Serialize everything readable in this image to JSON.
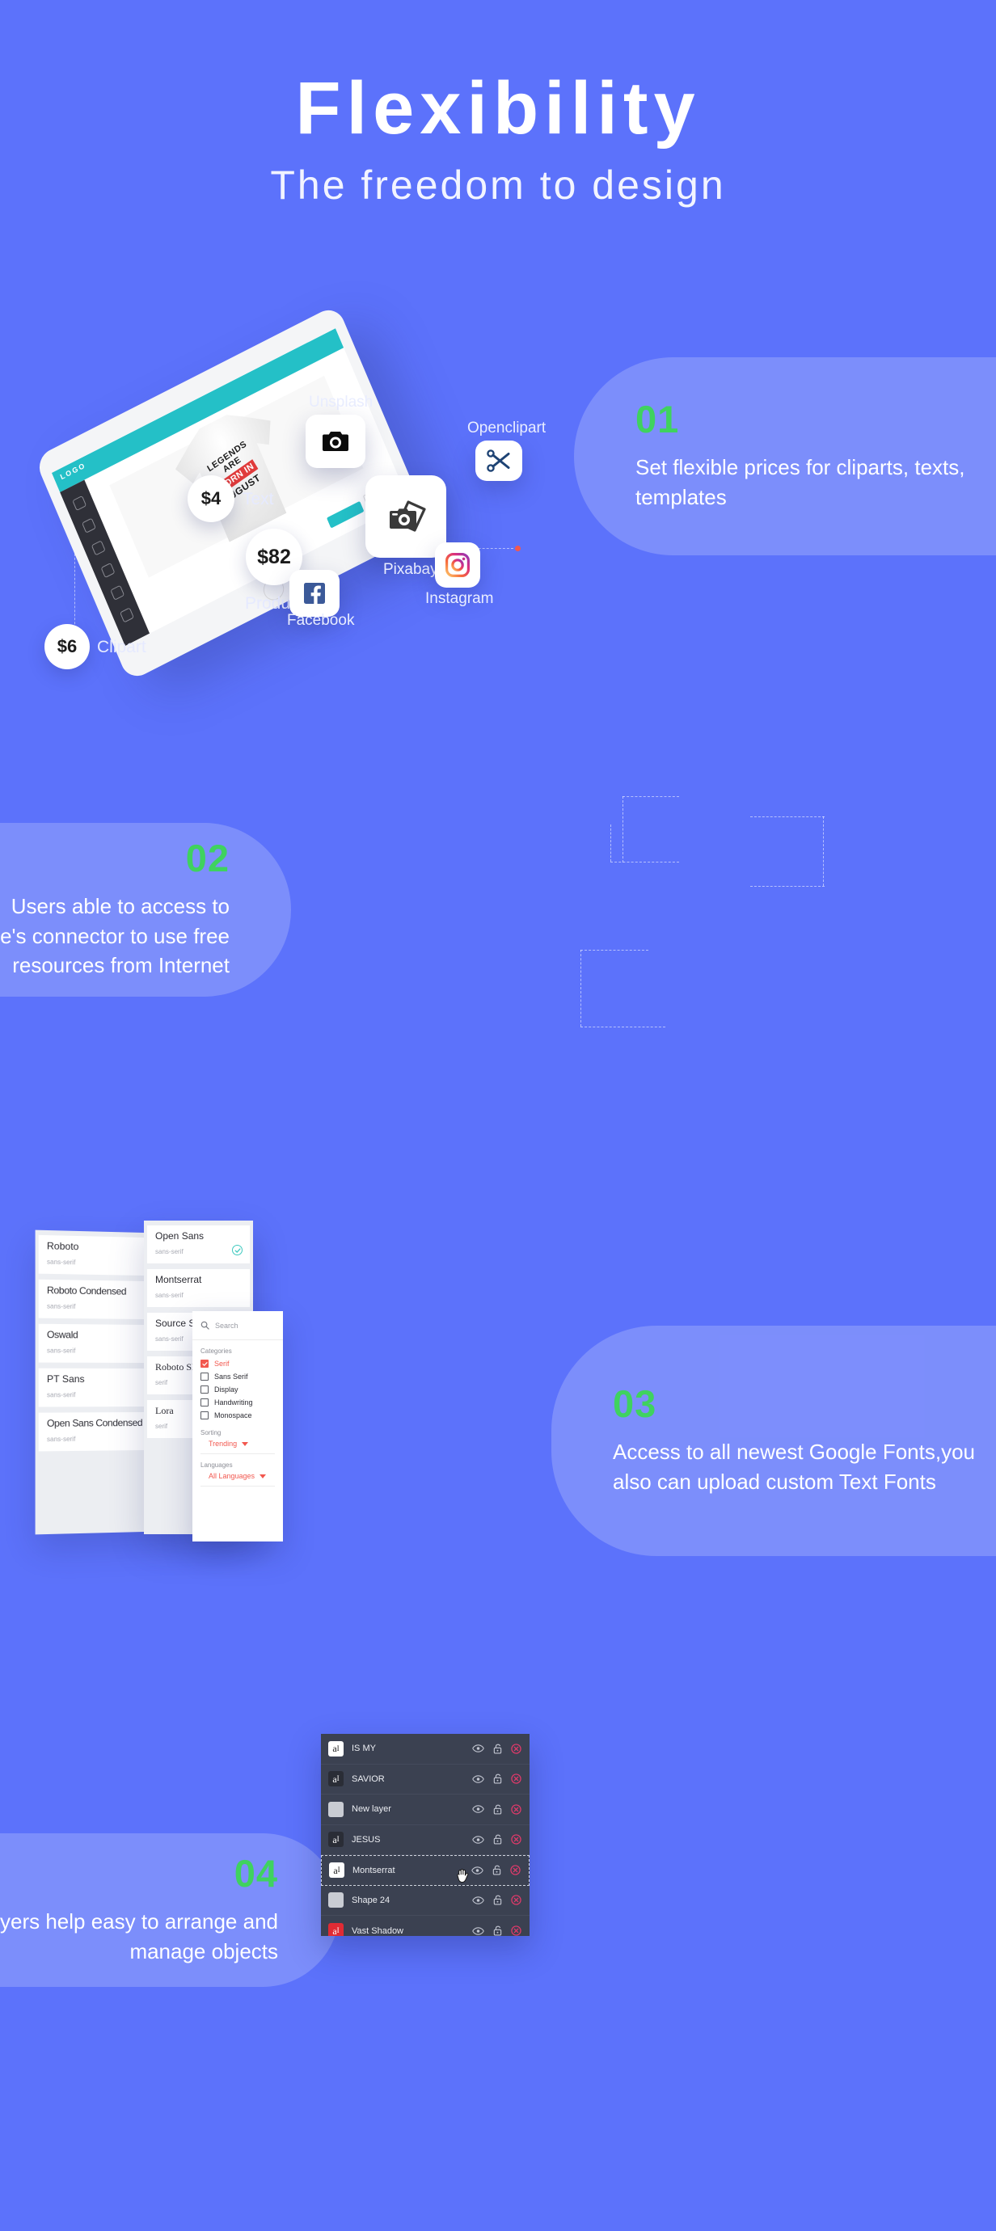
{
  "theme": {
    "background": "#5c72fb",
    "card_tint": "#7f94fc",
    "accent_green": "#3fd25f",
    "accent_red": "#f2584f",
    "accent_teal": "#3fc9bf",
    "panel_dark": "#3b4151"
  },
  "header": {
    "title": "Flexibility",
    "subtitle": "The freedom to design"
  },
  "section01": {
    "number": "01",
    "text": "Set flexible prices for cliparts, texts, templates",
    "bubbles": [
      {
        "price": "$4",
        "label": "Text"
      },
      {
        "price": "$82",
        "label": "Product"
      },
      {
        "price": "$6",
        "label": "Clipart"
      }
    ],
    "tablet": {
      "logo": "LOGO",
      "tee_line1": "LEGENDS ARE",
      "tee_line2": "BORN IN",
      "tee_line3": "AUGUST"
    }
  },
  "section02": {
    "number": "02",
    "text": "Users able to access to Lumise's connector to use free resources from Internet",
    "sources": [
      {
        "name": "Unsplash",
        "icon": "camera-icon"
      },
      {
        "name": "Openclipart",
        "icon": "scissors-icon"
      },
      {
        "name": "Pixabay",
        "icon": "camera-photos-icon"
      },
      {
        "name": "Instagram",
        "icon": "instagram-icon"
      },
      {
        "name": "Facebook",
        "icon": "facebook-icon"
      }
    ]
  },
  "section03": {
    "number": "03",
    "text": "Access to all newest Google Fonts,you also can upload custom Text Fonts",
    "fonts_left": [
      {
        "name": "Roboto",
        "category": "sans-serif",
        "selected": true
      },
      {
        "name": "Roboto Condensed",
        "category": "sans-serif",
        "selected": false
      },
      {
        "name": "Oswald",
        "category": "sans-serif",
        "selected": true
      },
      {
        "name": "PT Sans",
        "category": "sans-serif",
        "selected": false
      },
      {
        "name": "Open Sans Condensed",
        "category": "sans-serif",
        "selected": false
      }
    ],
    "fonts_right": [
      {
        "name": "Open Sans",
        "category": "sans-serif",
        "selected": true
      },
      {
        "name": "Montserrat",
        "category": "sans-serif",
        "selected": false
      },
      {
        "name": "Source Sans",
        "category": "sans-serif",
        "selected": false
      },
      {
        "name": "Roboto Slab",
        "category": "serif",
        "selected": false
      },
      {
        "name": "Lora",
        "category": "serif",
        "selected": false
      }
    ],
    "filter_panel": {
      "search_placeholder": "Search",
      "categories_label": "Categories",
      "categories": [
        {
          "label": "Serif",
          "checked": true
        },
        {
          "label": "Sans Serif",
          "checked": false
        },
        {
          "label": "Display",
          "checked": false
        },
        {
          "label": "Handwriting",
          "checked": false
        },
        {
          "label": "Monospace",
          "checked": false
        }
      ],
      "sorting_label": "Sorting",
      "sorting_value": "Trending",
      "languages_label": "Languages",
      "languages_value": "All Languages"
    }
  },
  "section04": {
    "number": "04",
    "text": "Layers help easy to arrange and manage objects",
    "layers": [
      {
        "name": "IS MY",
        "thumb": "text-white",
        "selected": false
      },
      {
        "name": "SAVIOR",
        "thumb": "text-dark",
        "selected": false
      },
      {
        "name": "New layer",
        "thumb": "shape-grey",
        "selected": false
      },
      {
        "name": "JESUS",
        "thumb": "text-dark",
        "selected": false
      },
      {
        "name": "Montserrat",
        "thumb": "text-white",
        "selected": true
      },
      {
        "name": "Shape 24",
        "thumb": "shape-grey",
        "selected": false
      },
      {
        "name": "Vast Shadow",
        "thumb": "text-red",
        "selected": false
      }
    ],
    "row_actions": [
      "eye-icon",
      "lock-icon",
      "delete-icon"
    ]
  }
}
